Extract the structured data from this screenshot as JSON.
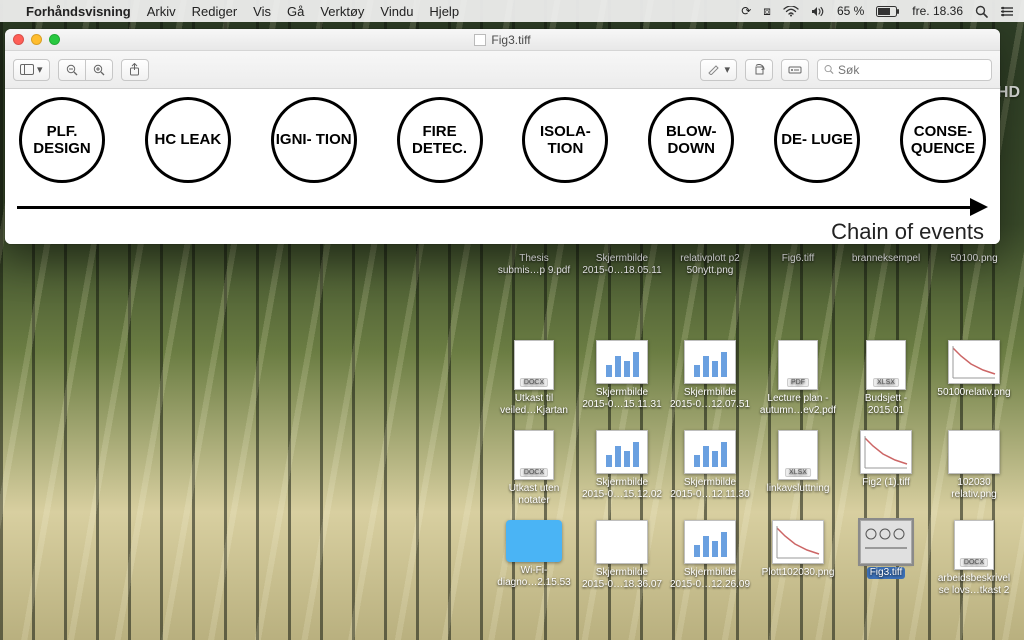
{
  "menubar": {
    "app_name": "Forhåndsvisning",
    "menus": [
      "Arkiv",
      "Rediger",
      "Vis",
      "Gå",
      "Verktøy",
      "Vindu",
      "Hjelp"
    ],
    "battery_percent": "65 %",
    "clock": "fre. 18.36"
  },
  "window": {
    "title": "Fig3.tiff",
    "search_placeholder": "Søk"
  },
  "diagram": {
    "nodes": [
      "PLF. DESIGN",
      "HC LEAK",
      "IGNI- TION",
      "FIRE DETEC.",
      "ISOLA- TION",
      "BLOW- DOWN",
      "DE- LUGE",
      "CONSE- QUENCE"
    ],
    "caption": "Chain of events"
  },
  "hd_mark": "HD",
  "desktop": {
    "rows": [
      [
        {
          "kind": "none"
        },
        {
          "kind": "label",
          "l1": "Thesis",
          "l2": "submis…p 9.pdf"
        },
        {
          "kind": "label",
          "l1": "Skjermbilde",
          "l2": "2015-0…18.05.11"
        },
        {
          "kind": "label",
          "l1": "relativplott p2",
          "l2": "50nytt.png"
        },
        {
          "kind": "label",
          "l1": "Fig6.tiff",
          "l2": ""
        },
        {
          "kind": "label",
          "l1": "branneksempel",
          "l2": ""
        },
        {
          "kind": "label",
          "l1": "50100.png",
          "l2": ""
        }
      ],
      [
        {
          "kind": "doc",
          "badge": "DOCX",
          "l1": "Utkast til",
          "l2": "veiled…Kjartan"
        },
        {
          "kind": "bars",
          "l1": "Skjermbilde",
          "l2": "2015-0…15.11.31"
        },
        {
          "kind": "bars",
          "l1": "Skjermbilde",
          "l2": "2015-0…12.07.51"
        },
        {
          "kind": "doc",
          "badge": "PDF",
          "l1": "Lecture plan -",
          "l2": "autumn…ev2.pdf"
        },
        {
          "kind": "doc",
          "badge": "XLSX",
          "l1": "Budsjett -",
          "l2": "2015.01"
        },
        {
          "kind": "curve",
          "l1": "50100relativ.png",
          "l2": ""
        }
      ],
      [
        {
          "kind": "doc",
          "badge": "DOCX",
          "l1": "Utkast uten",
          "l2": "notater"
        },
        {
          "kind": "bars",
          "l1": "Skjermbilde",
          "l2": "2015-0…15.12.02"
        },
        {
          "kind": "bars",
          "l1": "Skjermbilde",
          "l2": "2015-0…12.11.30"
        },
        {
          "kind": "doc",
          "badge": "XLSX",
          "l1": "linkavsluttning",
          "l2": ""
        },
        {
          "kind": "curve",
          "l1": "Fig2 (1).tiff",
          "l2": ""
        },
        {
          "kind": "plain",
          "l1": "102030",
          "l2": "relativ.png"
        }
      ],
      [
        {
          "kind": "folder",
          "l1": "Wi-Fi-",
          "l2": "diagno…2.15.53"
        },
        {
          "kind": "plain",
          "l1": "Skjermbilde",
          "l2": "2015-0…18.36.07"
        },
        {
          "kind": "bars",
          "l1": "Skjermbilde",
          "l2": "2015-0…12.26.09"
        },
        {
          "kind": "curve",
          "l1": "Plott102030.png",
          "l2": ""
        },
        {
          "kind": "selected",
          "l1": "Fig3.tiff",
          "l2": ""
        },
        {
          "kind": "doc",
          "badge": "DOCX",
          "l1": "arbeidsbeskrivel",
          "l2": "se lovs…tkast 2"
        }
      ]
    ]
  }
}
